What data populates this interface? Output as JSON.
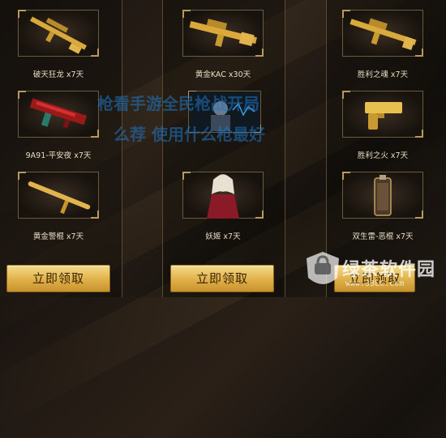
{
  "columns": [
    {
      "items": [
        {
          "name": "破天狂龙 x7天",
          "icon": "gold-sniper-rifle-icon"
        },
        {
          "name": "9A91-平安夜 x7天",
          "icon": "red-smg-icon"
        },
        {
          "name": "黄金警棍 x7天",
          "icon": "gold-baton-icon"
        }
      ],
      "button_label": "立即领取"
    },
    {
      "items": [
        {
          "name": "黄金KAC x30天",
          "icon": "gold-machine-gun-icon"
        },
        {
          "name": "",
          "icon": "character-portrait-icon"
        },
        {
          "name": "妖姬 x7天",
          "icon": "female-character-icon"
        }
      ],
      "button_label": "立即领取"
    },
    {
      "items": [
        {
          "name": "胜利之魂 x7天",
          "icon": "gold-assault-rifle-icon"
        },
        {
          "name": "胜利之火 x7天",
          "icon": "gold-pistol-icon"
        },
        {
          "name": "双生雷-恶棍 x7天",
          "icon": "grenade-icon"
        }
      ],
      "button_label": "立即领取"
    }
  ],
  "overlay": {
    "line1": "枪看手游全民枪战开局",
    "line2": "么荐 使用什么枪最好"
  },
  "watermark": {
    "brand": "绿茶软件园",
    "url": "www.33LC.com",
    "icon": "shield-logo-icon"
  },
  "colors": {
    "gold": "#e2b44e",
    "frame_border": "#6b5a3e",
    "label_text": "#e8dcc4",
    "overlay_blue": "#1e78c8"
  }
}
